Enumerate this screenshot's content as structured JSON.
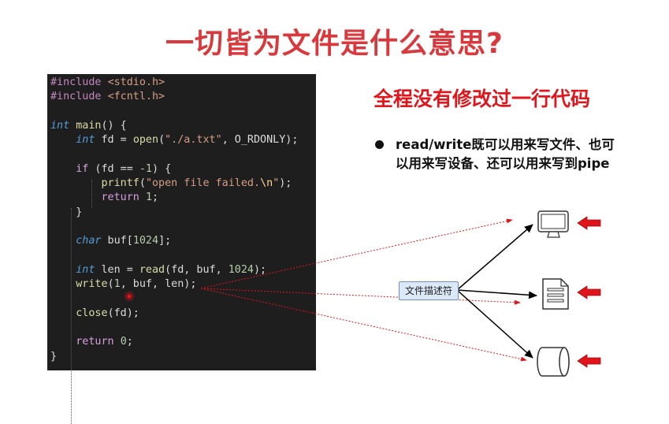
{
  "title": "一切皆为文件是什么意思?",
  "subtitle": "全程没有修改过一行代码",
  "bullet": {
    "line1": "read/write既可以用来写文件、也可",
    "line2": "以用来写设备、还可以用来写到pipe"
  },
  "fd_label": "文件描述符",
  "icons": [
    "monitor-icon",
    "document-icon",
    "cylinder-pipe-icon",
    "red-arrow-icon"
  ],
  "colors": {
    "title": "#d9393c",
    "subtitle": "#e1161c",
    "code_bg": "#1e1e1e",
    "arrow_red": "#e0141b",
    "fd_box": "#dbe8f7"
  },
  "code": [
    [
      {
        "t": "#include ",
        "c": "kw-inc"
      },
      {
        "t": "<stdio.h>",
        "c": "str"
      }
    ],
    [
      {
        "t": "#include ",
        "c": "kw-inc"
      },
      {
        "t": "<fcntl.h>",
        "c": "str"
      }
    ],
    [],
    [
      {
        "t": "int",
        "c": "kw-type"
      },
      {
        "t": " ",
        "c": "plain"
      },
      {
        "t": "main",
        "c": "fn"
      },
      {
        "t": "() {",
        "c": "plain"
      }
    ],
    [
      {
        "t": "    ",
        "c": "plain"
      },
      {
        "t": "int",
        "c": "kw-type"
      },
      {
        "t": " fd = ",
        "c": "plain"
      },
      {
        "t": "open",
        "c": "fn"
      },
      {
        "t": "(",
        "c": "plain"
      },
      {
        "t": "\"./a.txt\"",
        "c": "str"
      },
      {
        "t": ", O_RDONLY);",
        "c": "plain"
      }
    ],
    [],
    [
      {
        "t": "    ",
        "c": "plain"
      },
      {
        "t": "if",
        "c": "kw-ctl"
      },
      {
        "t": " (fd == ",
        "c": "plain"
      },
      {
        "t": "-1",
        "c": "num"
      },
      {
        "t": ") {",
        "c": "plain"
      }
    ],
    [
      {
        "t": "        ",
        "c": "plain"
      },
      {
        "t": "printf",
        "c": "fn"
      },
      {
        "t": "(",
        "c": "plain"
      },
      {
        "t": "\"open file failed.",
        "c": "str"
      },
      {
        "t": "\\n",
        "c": "esc"
      },
      {
        "t": "\"",
        "c": "str"
      },
      {
        "t": ");",
        "c": "plain"
      }
    ],
    [
      {
        "t": "        ",
        "c": "plain"
      },
      {
        "t": "return",
        "c": "kw-ctl"
      },
      {
        "t": " ",
        "c": "plain"
      },
      {
        "t": "1",
        "c": "num"
      },
      {
        "t": ";",
        "c": "plain"
      }
    ],
    [
      {
        "t": "    }",
        "c": "plain"
      }
    ],
    [],
    [
      {
        "t": "    ",
        "c": "plain"
      },
      {
        "t": "char",
        "c": "kw-type"
      },
      {
        "t": " buf[",
        "c": "plain"
      },
      {
        "t": "1024",
        "c": "num"
      },
      {
        "t": "];",
        "c": "plain"
      }
    ],
    [],
    [
      {
        "t": "    ",
        "c": "plain"
      },
      {
        "t": "int",
        "c": "kw-type"
      },
      {
        "t": " len = ",
        "c": "plain"
      },
      {
        "t": "read",
        "c": "fn"
      },
      {
        "t": "(fd, buf, ",
        "c": "plain"
      },
      {
        "t": "1024",
        "c": "num"
      },
      {
        "t": ");",
        "c": "plain"
      }
    ],
    [
      {
        "t": "    ",
        "c": "plain"
      },
      {
        "t": "write",
        "c": "fn"
      },
      {
        "t": "(",
        "c": "plain"
      },
      {
        "t": "1",
        "c": "num"
      },
      {
        "t": ", buf, len);",
        "c": "plain"
      }
    ],
    [],
    [
      {
        "t": "    ",
        "c": "plain"
      },
      {
        "t": "close",
        "c": "fn"
      },
      {
        "t": "(fd);",
        "c": "plain"
      }
    ],
    [],
    [
      {
        "t": "    ",
        "c": "plain"
      },
      {
        "t": "return",
        "c": "kw-ctl"
      },
      {
        "t": " ",
        "c": "plain"
      },
      {
        "t": "0",
        "c": "num"
      },
      {
        "t": ";",
        "c": "plain"
      }
    ],
    [
      {
        "t": "}",
        "c": "plain"
      }
    ]
  ]
}
